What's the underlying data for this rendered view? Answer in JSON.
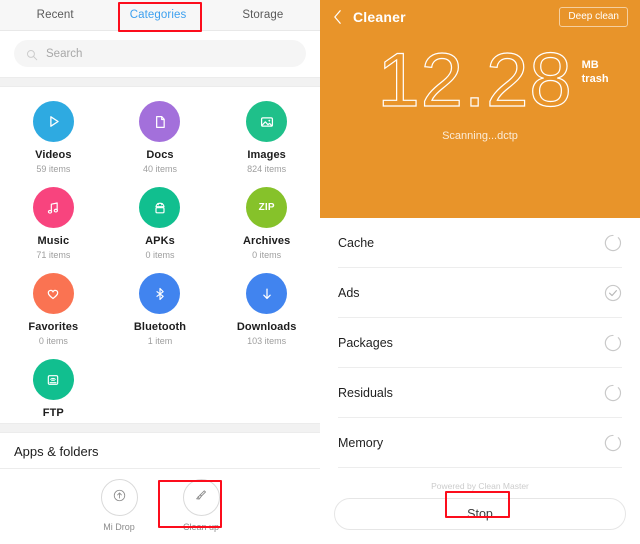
{
  "file_manager": {
    "tabs": [
      {
        "label": "Recent",
        "active": false
      },
      {
        "label": "Categories",
        "active": true
      },
      {
        "label": "Storage",
        "active": false
      }
    ],
    "search": {
      "placeholder": "Search",
      "value": "",
      "icon": "search-icon"
    },
    "categories": [
      {
        "label": "Videos",
        "count": "59 items",
        "color": "#2eaae1",
        "icon": "play-icon"
      },
      {
        "label": "Docs",
        "count": "40 items",
        "color": "#a370db",
        "icon": "document-icon"
      },
      {
        "label": "Images",
        "count": "824 items",
        "color": "#1fc08a",
        "icon": "image-icon"
      },
      {
        "label": "Music",
        "count": "71 items",
        "color": "#f8447e",
        "icon": "music-note-icon"
      },
      {
        "label": "APKs",
        "count": "0 items",
        "color": "#11bf8f",
        "icon": "android-icon"
      },
      {
        "label": "Archives",
        "count": "0 items",
        "color": "#86c22a",
        "icon": "zip-icon",
        "icon_text": "ZIP"
      },
      {
        "label": "Favorites",
        "count": "0 items",
        "color": "#fa7352",
        "icon": "heart-icon"
      },
      {
        "label": "Bluetooth",
        "count": "1 item",
        "color": "#4184ef",
        "icon": "bluetooth-icon"
      },
      {
        "label": "Downloads",
        "count": "103 items",
        "color": "#4184ef",
        "icon": "download-arrow-icon"
      },
      {
        "label": "FTP",
        "count": "",
        "color": "#11bf8f",
        "icon": "ftp-monitor-wifi-icon"
      }
    ],
    "apps_section": {
      "title": "Apps & folders",
      "items": [
        {
          "label": "Mi Drop",
          "icon": "upload-circle-icon"
        },
        {
          "label": "Clean up",
          "icon": "broom-icon"
        }
      ]
    }
  },
  "cleaner": {
    "title": "Cleaner",
    "back_icon": "chevron-left-icon",
    "deep_clean_label": "Deep clean",
    "amount": "12.28",
    "unit_line1": "MB",
    "unit_line2": "trash",
    "status": "Scanning...dctp",
    "header_color": "#e8942a",
    "scan_items": [
      {
        "label": "Cache",
        "state": "scanning",
        "icon": "spinner-icon"
      },
      {
        "label": "Ads",
        "state": "done",
        "icon": "check-circle-icon"
      },
      {
        "label": "Packages",
        "state": "scanning",
        "icon": "spinner-icon"
      },
      {
        "label": "Residuals",
        "state": "scanning",
        "icon": "spinner-icon"
      },
      {
        "label": "Memory",
        "state": "scanning",
        "icon": "spinner-icon"
      }
    ],
    "powered_by": "Powered by Clean Master",
    "stop_label": "Stop"
  },
  "annotations": {
    "highlight_color": "#fc0d1c",
    "boxes": [
      "categories-tab",
      "clean-up-button",
      "stop-button"
    ]
  }
}
